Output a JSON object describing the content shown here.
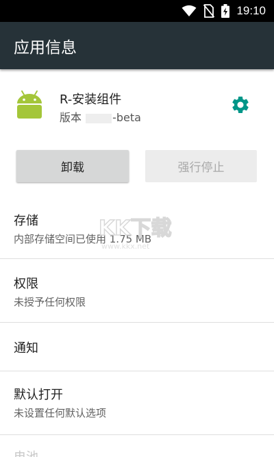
{
  "status_bar": {
    "time": "19:10",
    "icons": [
      "wifi-icon",
      "no-sim-icon",
      "battery-charging-icon"
    ]
  },
  "app_bar": {
    "title": "应用信息"
  },
  "app": {
    "name": "R-安装组件",
    "version_prefix": "版本",
    "version_suffix": "-beta",
    "icon": "android-icon",
    "settings_icon": "gear-icon"
  },
  "buttons": {
    "uninstall": "卸载",
    "force_stop": "强行停止"
  },
  "settings": [
    {
      "title": "存储",
      "subtitle": "内部存储空间已使用 1.75 MB"
    },
    {
      "title": "权限",
      "subtitle": "未授予任何权限"
    },
    {
      "title": "通知",
      "subtitle": ""
    },
    {
      "title": "默认打开",
      "subtitle": "未设置任何默认选项"
    },
    {
      "title": "电池",
      "subtitle": ""
    }
  ],
  "watermark": {
    "text": "KK下载",
    "url": "www.kkx.net"
  },
  "colors": {
    "app_bar": "#263238",
    "accent": "#009688",
    "android_green": "#a4c639"
  }
}
